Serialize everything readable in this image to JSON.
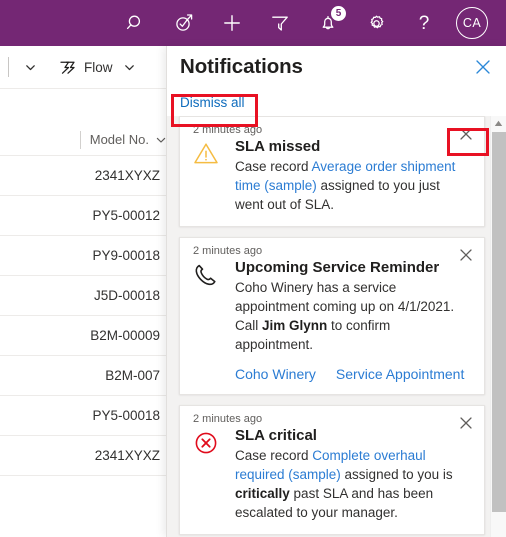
{
  "topbar": {
    "background": "#742774",
    "icons": [
      {
        "name": "search-icon",
        "label": "Search"
      },
      {
        "name": "assistant-icon",
        "label": "Assistant"
      },
      {
        "name": "quick-create-icon",
        "label": "Quick Create"
      },
      {
        "name": "filter-icon",
        "label": "Filter"
      },
      {
        "name": "notifications-bell-icon",
        "label": "Notifications",
        "badge": "5"
      },
      {
        "name": "settings-gear-icon",
        "label": "Settings"
      },
      {
        "name": "help-icon",
        "label": "Help"
      }
    ],
    "help_glyph": "?",
    "avatar_initials": "CA"
  },
  "background_grid": {
    "command_bar": {
      "overflow_chevron": "⌄",
      "flow_label": "Flow",
      "flow_chevron": "⌄"
    },
    "column_header": "Model No.",
    "column_header_chevron": "⌄",
    "rows": [
      "2341XYXZ",
      "PY5-00012",
      "PY9-00018",
      "J5D-00018",
      "B2M-00009",
      "B2M-007",
      "PY5-00018",
      "2341XYXZ"
    ]
  },
  "panel": {
    "title": "Notifications",
    "close_label": "Close",
    "dismiss_all_label": "Dismiss all",
    "link_color": "#0f6cbd",
    "cards": [
      {
        "time": "2 minutes ago",
        "icon": "warning-triangle-icon",
        "icon_color": "#f5bc42",
        "title": "SLA missed",
        "text_parts": [
          {
            "t": "Case record ",
            "style": "plain"
          },
          {
            "t": "Average order shipment time (sample)",
            "style": "link"
          },
          {
            "t": " assigned to you just went out of SLA.",
            "style": "plain"
          }
        ],
        "dismiss_label": "Dismiss",
        "links": []
      },
      {
        "time": "2 minutes ago",
        "icon": "phone-icon",
        "icon_color": "#201f1e",
        "title": "Upcoming Service Reminder",
        "text_parts": [
          {
            "t": "Coho Winery has a service appointment coming up on 4/1/2021. Call ",
            "style": "plain"
          },
          {
            "t": "Jim Glynn",
            "style": "bold"
          },
          {
            "t": " to confirm appointment.",
            "style": "plain"
          }
        ],
        "dismiss_label": "Dismiss",
        "links": [
          "Coho Winery",
          "Service Appointment"
        ]
      },
      {
        "time": "2 minutes ago",
        "icon": "error-circle-x-icon",
        "icon_color": "#e00b1c",
        "title": "SLA critical",
        "text_parts": [
          {
            "t": "Case record ",
            "style": "plain"
          },
          {
            "t": "Complete overhaul required (sample)",
            "style": "link"
          },
          {
            "t": " assigned to you is ",
            "style": "plain"
          },
          {
            "t": "critically",
            "style": "bold"
          },
          {
            "t": " past SLA and has been escalated to your manager.",
            "style": "plain"
          }
        ],
        "dismiss_label": "Dismiss",
        "links": []
      }
    ]
  },
  "scrollbar": {
    "up_arrow": "▲"
  },
  "annotations": {
    "color": "#e81123",
    "boxes": [
      {
        "name": "highlight-dismiss-all"
      },
      {
        "name": "highlight-card-dismiss"
      }
    ]
  }
}
